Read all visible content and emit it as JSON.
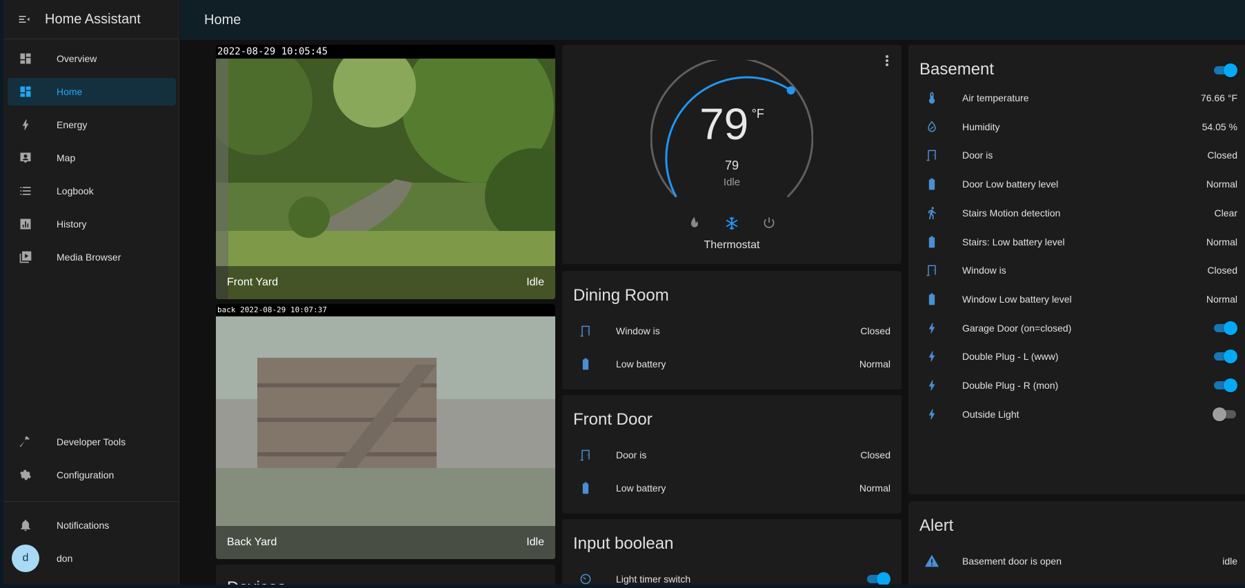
{
  "app": {
    "title": "Home Assistant"
  },
  "page": {
    "title": "Home"
  },
  "sidebar": {
    "items": [
      {
        "label": "Overview",
        "icon": "dashboard-icon"
      },
      {
        "label": "Home",
        "icon": "dashboard-icon",
        "active": true
      },
      {
        "label": "Energy",
        "icon": "lightning-icon"
      },
      {
        "label": "Map",
        "icon": "account-box-icon"
      },
      {
        "label": "Logbook",
        "icon": "list-icon"
      },
      {
        "label": "History",
        "icon": "chart-box-icon"
      },
      {
        "label": "Media Browser",
        "icon": "play-box-icon"
      }
    ],
    "developer_tools": "Developer Tools",
    "configuration": "Configuration",
    "notifications": "Notifications",
    "user": {
      "initial": "d",
      "name": "don"
    }
  },
  "cameras": {
    "front": {
      "timestamp": "2022-08-29 10:05:45",
      "name": "Front Yard",
      "state": "Idle"
    },
    "back": {
      "timestamp": "back 2022-08-29 10:07:37",
      "name": "Back Yard",
      "state": "Idle"
    },
    "next_title": "Devices"
  },
  "thermostat": {
    "temp": "79",
    "unit": "°F",
    "target": "79",
    "action": "Idle",
    "name": "Thermostat",
    "accent": "#2196f3"
  },
  "dining": {
    "title": "Dining Room",
    "rows": [
      {
        "name": "Window is",
        "state": "Closed"
      },
      {
        "name": "Low battery",
        "state": "Normal"
      }
    ]
  },
  "front_door": {
    "title": "Front Door",
    "rows": [
      {
        "name": "Door is",
        "state": "Closed"
      },
      {
        "name": "Low battery",
        "state": "Normal"
      }
    ]
  },
  "input_boolean": {
    "title": "Input boolean",
    "rows": [
      {
        "name": "Light timer switch",
        "on": true
      }
    ]
  },
  "basement": {
    "title": "Basement",
    "rows": [
      {
        "name": "Air temperature",
        "state": "76.66 °F"
      },
      {
        "name": "Humidity",
        "state": "54.05 %"
      },
      {
        "name": "Door is",
        "state": "Closed"
      },
      {
        "name": "Door Low battery level",
        "state": "Normal"
      },
      {
        "name": "Stairs Motion detection",
        "state": "Clear"
      },
      {
        "name": "Stairs: Low battery level",
        "state": "Normal"
      },
      {
        "name": "Window is",
        "state": "Closed"
      },
      {
        "name": "Window Low battery level",
        "state": "Normal"
      },
      {
        "name": "Garage Door (on=closed)",
        "on": true
      },
      {
        "name": "Double Plug - L (www)",
        "on": true
      },
      {
        "name": "Double Plug - R (mon)",
        "on": true
      },
      {
        "name": "Outside Light",
        "on": false
      }
    ]
  },
  "alert": {
    "title": "Alert",
    "rows": [
      {
        "name": "Basement door is open",
        "state": "idle"
      }
    ]
  }
}
